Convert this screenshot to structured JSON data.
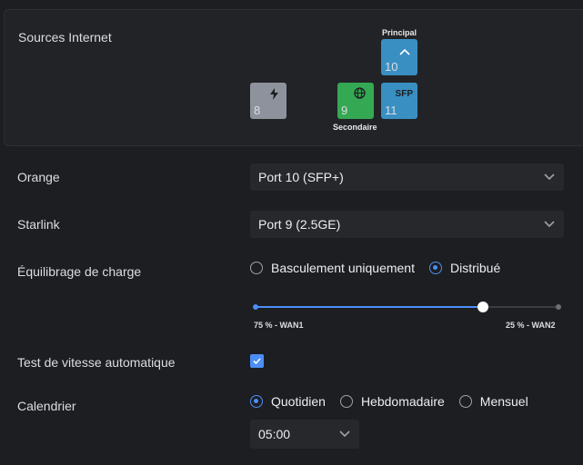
{
  "sources": {
    "title": "Sources Internet",
    "principal_caption": "Principal",
    "secondaire_caption": "Secondaire",
    "ports": [
      {
        "number": "8",
        "icon": "lightning-icon",
        "color": "#8e929c"
      },
      {
        "number": "9",
        "icon": "globe-icon",
        "color": "#35a853"
      },
      {
        "number": "10",
        "icon": "chevron-up-icon",
        "color": "#3a8fc2"
      },
      {
        "number": "11",
        "icon_text": "SFP",
        "color": "#3a8fc2"
      }
    ]
  },
  "wan1": {
    "label": "Orange",
    "value": "Port 10 (SFP+)"
  },
  "wan2": {
    "label": "Starlink",
    "value": "Port 9 (2.5GE)"
  },
  "load_balancing": {
    "label": "Équilibrage de charge",
    "options": [
      "Basculement uniquement",
      "Distribué"
    ],
    "selected": "Distribué",
    "slider": {
      "wan1_percent": 75,
      "wan1_label": "75 % - WAN1",
      "wan2_label": "25 % - WAN2"
    }
  },
  "speedtest": {
    "label": "Test de vitesse automatique",
    "checked": true
  },
  "schedule": {
    "label": "Calendrier",
    "options": [
      "Quotidien",
      "Hebdomadaire",
      "Mensuel"
    ],
    "selected": "Quotidien",
    "time": "05:00"
  },
  "colors": {
    "accent": "#4c8ef7",
    "background": "#1c1e21"
  }
}
